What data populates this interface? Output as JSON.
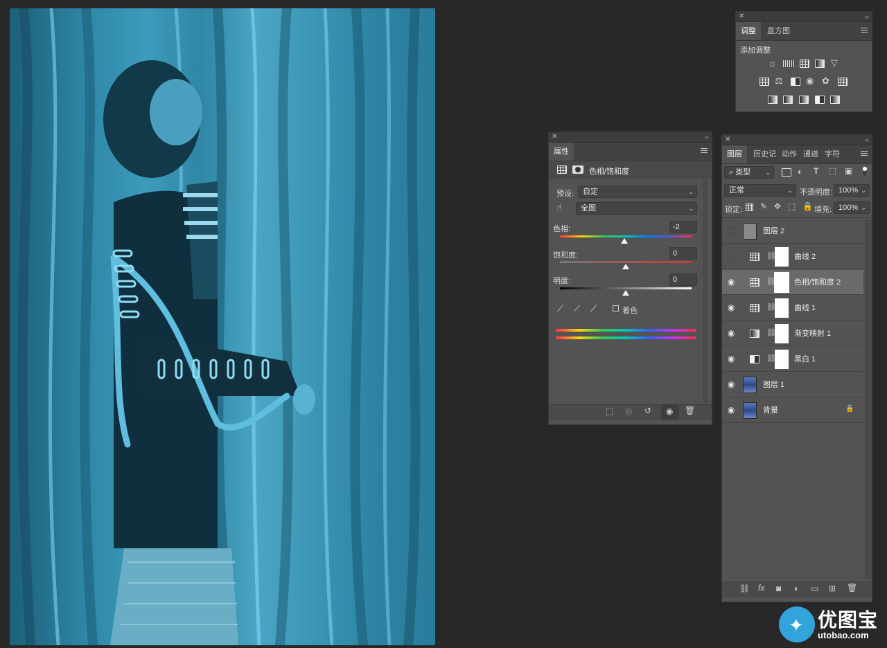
{
  "adjustments_panel": {
    "tabs": [
      "调整",
      "直方图"
    ],
    "heading": "添加调整"
  },
  "properties_panel": {
    "tab": "属性",
    "type_label": "色相/饱和度",
    "preset_label": "预设:",
    "preset_value": "自定",
    "range_value": "全图",
    "hue_label": "色相:",
    "hue_value": "-2",
    "hue_fraction": 0.49,
    "saturation_label": "饱和度:",
    "saturation_value": "0",
    "saturation_fraction": 0.5,
    "lightness_label": "明度:",
    "lightness_value": "0",
    "lightness_fraction": 0.5,
    "colorize_label": "着色"
  },
  "layers_panel": {
    "tabs": [
      "图层",
      "历史记",
      "动作",
      "通道",
      "字符"
    ],
    "filter_kind": "类型",
    "blend_mode": "正常",
    "opacity_label": "不透明度:",
    "opacity_value": "100%",
    "lock_label": "锁定:",
    "fill_label": "填充:",
    "fill_value": "100%",
    "layers": [
      {
        "name": "图层 2",
        "visible": false,
        "kind": "pixel-gray"
      },
      {
        "name": "曲线 2",
        "visible": false,
        "kind": "curves"
      },
      {
        "name": "色相/饱和度 2",
        "visible": true,
        "kind": "hue",
        "selected": true
      },
      {
        "name": "曲线 1",
        "visible": true,
        "kind": "curves"
      },
      {
        "name": "渐变映射 1",
        "visible": true,
        "kind": "gradient"
      },
      {
        "name": "黑白 1",
        "visible": true,
        "kind": "bw"
      },
      {
        "name": "图层 1",
        "visible": true,
        "kind": "photo"
      },
      {
        "name": "背景",
        "visible": true,
        "kind": "photo",
        "locked": true
      }
    ]
  },
  "watermark": {
    "brand": "优图宝",
    "url": "utobao.com"
  },
  "colors": {
    "ui_bg": "#282828",
    "panel": "#535353",
    "photo_tint": "#2e87a6"
  }
}
